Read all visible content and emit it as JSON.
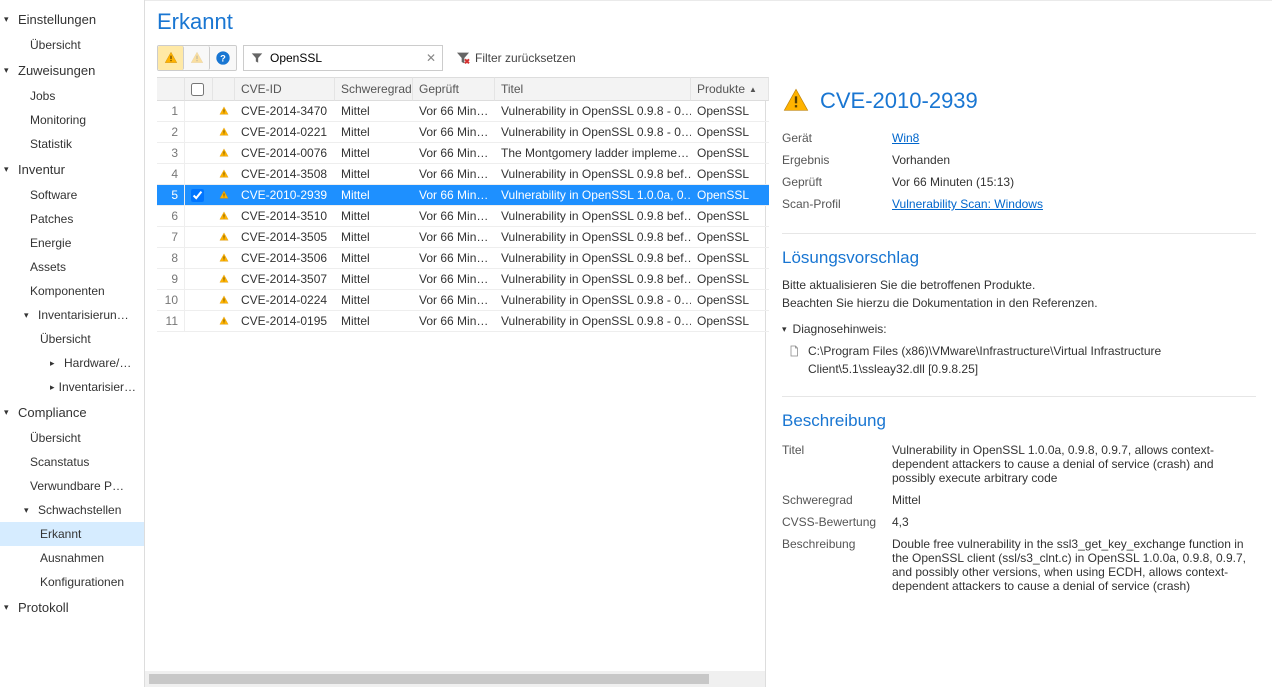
{
  "sidebar": {
    "sections": [
      {
        "label": "Einstellungen",
        "expanded": true,
        "items": [
          {
            "label": "Übersicht"
          }
        ]
      },
      {
        "label": "Zuweisungen",
        "expanded": true,
        "items": [
          {
            "label": "Jobs"
          },
          {
            "label": "Monitoring"
          },
          {
            "label": "Statistik"
          }
        ]
      },
      {
        "label": "Inventur",
        "expanded": true,
        "items": [
          {
            "label": "Software"
          },
          {
            "label": "Patches"
          },
          {
            "label": "Energie"
          },
          {
            "label": "Assets"
          },
          {
            "label": "Komponenten"
          },
          {
            "label": "Inventarisierun…",
            "group": true,
            "sub": [
              {
                "label": "Übersicht"
              },
              {
                "label": "Hardware/…",
                "arrow": true
              },
              {
                "label": "Inventarisier…",
                "arrow": true
              }
            ]
          }
        ]
      },
      {
        "label": "Compliance",
        "expanded": true,
        "items": [
          {
            "label": "Übersicht"
          },
          {
            "label": "Scanstatus"
          },
          {
            "label": "Verwundbare P…"
          },
          {
            "label": "Schwachstellen",
            "group": true,
            "sub": [
              {
                "label": "Erkannt",
                "active": true
              },
              {
                "label": "Ausnahmen"
              },
              {
                "label": "Konfigurationen"
              }
            ]
          }
        ]
      },
      {
        "label": "Protokoll",
        "expanded": true,
        "items": []
      }
    ]
  },
  "page_title": "Erkannt",
  "toolbar": {
    "filter_value": "OpenSSL",
    "reset_label": "Filter zurücksetzen"
  },
  "table": {
    "headers": {
      "cve": "CVE-ID",
      "sev": "Schweregrad",
      "checked": "Geprüft",
      "title": "Titel",
      "products": "Produkte"
    },
    "rows": [
      {
        "num": "1",
        "cve": "CVE-2014-3470",
        "sev": "Mittel",
        "checked": "Vor 66 Min…",
        "title": "Vulnerability in OpenSSL 0.9.8 - 0…",
        "prod": "OpenSSL"
      },
      {
        "num": "2",
        "cve": "CVE-2014-0221",
        "sev": "Mittel",
        "checked": "Vor 66 Min…",
        "title": "Vulnerability in OpenSSL 0.9.8 - 0…",
        "prod": "OpenSSL"
      },
      {
        "num": "3",
        "cve": "CVE-2014-0076",
        "sev": "Mittel",
        "checked": "Vor 66 Min…",
        "title": "The Montgomery ladder impleme…",
        "prod": "OpenSSL"
      },
      {
        "num": "4",
        "cve": "CVE-2014-3508",
        "sev": "Mittel",
        "checked": "Vor 66 Min…",
        "title": "Vulnerability in OpenSSL 0.9.8 bef…",
        "prod": "OpenSSL"
      },
      {
        "num": "5",
        "cve": "CVE-2010-2939",
        "sev": "Mittel",
        "checked": "Vor 66 Min…",
        "title": "Vulnerability in OpenSSL 1.0.0a, 0.…",
        "prod": "OpenSSL",
        "selected": true,
        "checked_box": true
      },
      {
        "num": "6",
        "cve": "CVE-2014-3510",
        "sev": "Mittel",
        "checked": "Vor 66 Min…",
        "title": "Vulnerability in OpenSSL 0.9.8 bef…",
        "prod": "OpenSSL"
      },
      {
        "num": "7",
        "cve": "CVE-2014-3505",
        "sev": "Mittel",
        "checked": "Vor 66 Min…",
        "title": "Vulnerability in OpenSSL 0.9.8 bef…",
        "prod": "OpenSSL"
      },
      {
        "num": "8",
        "cve": "CVE-2014-3506",
        "sev": "Mittel",
        "checked": "Vor 66 Min…",
        "title": "Vulnerability in OpenSSL 0.9.8 bef…",
        "prod": "OpenSSL"
      },
      {
        "num": "9",
        "cve": "CVE-2014-3507",
        "sev": "Mittel",
        "checked": "Vor 66 Min…",
        "title": "Vulnerability in OpenSSL 0.9.8 bef…",
        "prod": "OpenSSL"
      },
      {
        "num": "10",
        "cve": "CVE-2014-0224",
        "sev": "Mittel",
        "checked": "Vor 66 Min…",
        "title": "Vulnerability in OpenSSL 0.9.8 - 0…",
        "prod": "OpenSSL"
      },
      {
        "num": "11",
        "cve": "CVE-2014-0195",
        "sev": "Mittel",
        "checked": "Vor 66 Min…",
        "title": "Vulnerability in OpenSSL 0.9.8 - 0…",
        "prod": "OpenSSL"
      }
    ]
  },
  "detail": {
    "title": "CVE-2010-2939",
    "kv": {
      "device_k": "Gerät",
      "device_v": "Win8",
      "result_k": "Ergebnis",
      "result_v": "Vorhanden",
      "checked_k": "Geprüft",
      "checked_v": "Vor 66 Minuten (15:13)",
      "profile_k": "Scan-Profil",
      "profile_v": "Vulnerability Scan: Windows"
    },
    "solution_title": "Lösungsvorschlag",
    "solution_text1": "Bitte aktualisieren Sie die betroffenen Produkte.",
    "solution_text2": "Beachten Sie hierzu die Dokumentation in den Referenzen.",
    "diag_header": "Diagnosehinweis:",
    "diag_path": "C:\\Program Files (x86)\\VMware\\Infrastructure\\Virtual Infrastructure Client\\5.1\\ssleay32.dll [0.9.8.25]",
    "desc_title": "Beschreibung",
    "desc": {
      "title_k": "Titel",
      "title_v": "Vulnerability in OpenSSL 1.0.0a, 0.9.8, 0.9.7, allows context-dependent attackers to cause a denial of service (crash) and possibly execute arbitrary code",
      "sev_k": "Schweregrad",
      "sev_v": "Mittel",
      "cvss_k": "CVSS-Bewertung",
      "cvss_v": "4,3",
      "desc_k": "Beschreibung",
      "desc_v": "Double free vulnerability in the ssl3_get_key_exchange function in the OpenSSL client (ssl/s3_clnt.c) in OpenSSL 1.0.0a, 0.9.8, 0.9.7, and possibly other versions, when using ECDH, allows context-dependent attackers to cause a denial of service (crash)"
    }
  }
}
